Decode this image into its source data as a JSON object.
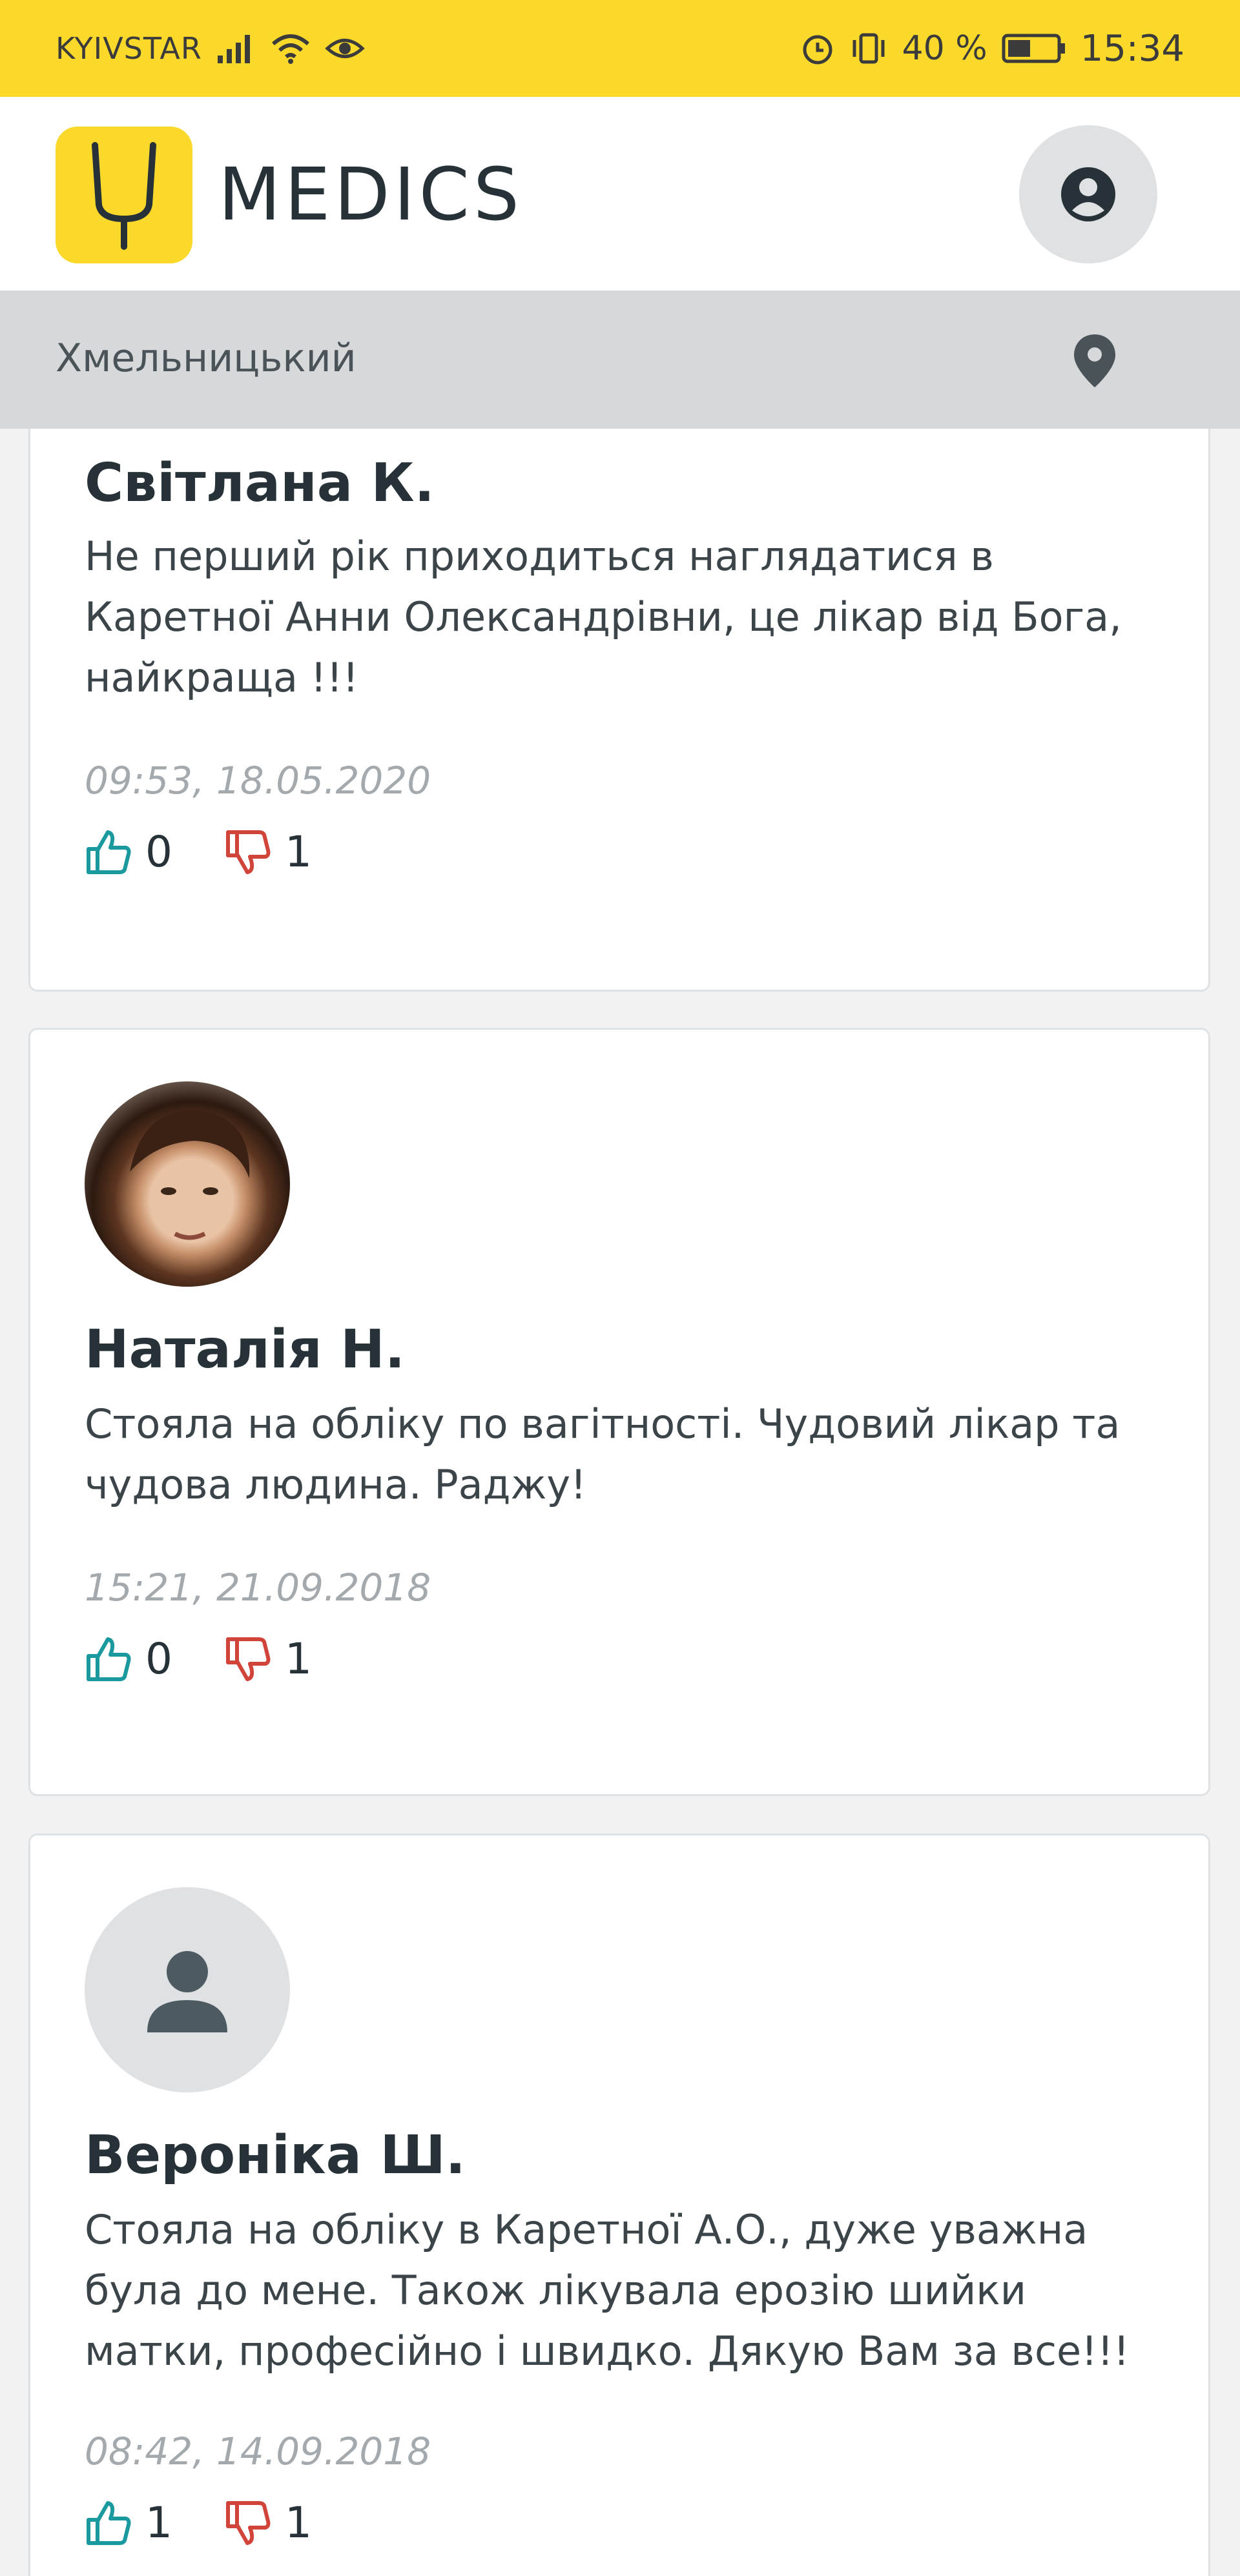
{
  "status_bar": {
    "carrier": "KYIVSTAR",
    "battery": "40 %",
    "time": "15:34"
  },
  "header": {
    "brand": "MEDICS",
    "icons": {
      "logo": "stethoscope-icon",
      "user": "user-icon"
    }
  },
  "city_bar": {
    "city": "Хмельницький",
    "icon": "location-pin-icon"
  },
  "colors": {
    "brand_yellow": "#fbd92b",
    "like": "#1a9a9e",
    "dislike": "#d0443a",
    "text_dark": "#263238"
  },
  "reviews": [
    {
      "author": "Світлана К.",
      "text": "Не перший рік приходиться наглядатися в Каретної Анни Олександрівни, це лікар від Бога, найкраща !!!",
      "date": "09:53, 18.05.2020",
      "likes": "0",
      "dislikes": "1"
    },
    {
      "author": "Наталія Н.",
      "text": "Стояла на обліку по вагітності. Чудовий лікар та чудова людина. Раджу!",
      "date": "15:21, 21.09.2018",
      "likes": "0",
      "dislikes": "1"
    },
    {
      "author": "Вероніка Ш.",
      "text": "Стояла на обліку в Каретної А.О., дуже уважна була до мене. Також лікувала ерозію шийки матки, професійно і швидко. Дякую Вам за все!!!",
      "date": "08:42, 14.09.2018",
      "likes": "1",
      "dislikes": "1"
    }
  ]
}
